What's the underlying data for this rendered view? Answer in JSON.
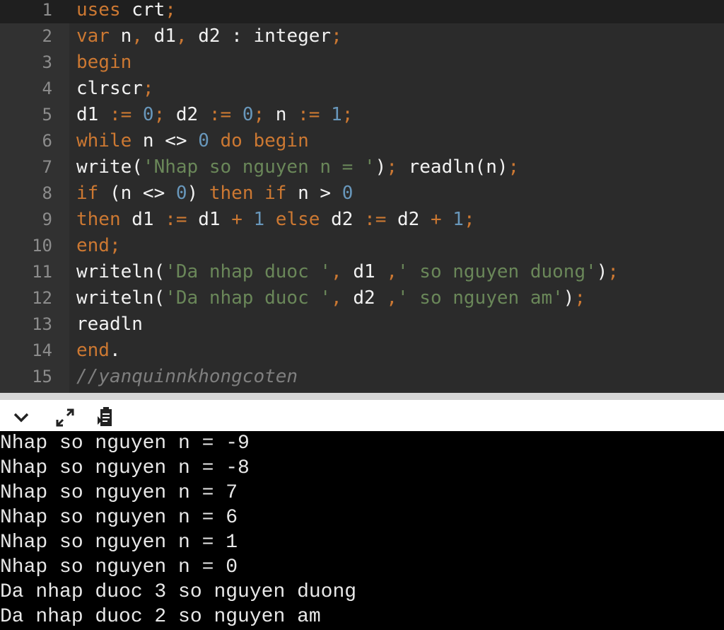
{
  "editor": {
    "lines": [
      {
        "n": "1",
        "tokens": [
          [
            "kw",
            "uses"
          ],
          [
            "",
            " crt"
          ],
          [
            "op",
            ";"
          ]
        ]
      },
      {
        "n": "2",
        "tokens": [
          [
            "kw",
            "var"
          ],
          [
            "",
            " n"
          ],
          [
            "op",
            ","
          ],
          [
            "",
            " d1"
          ],
          [
            "op",
            ","
          ],
          [
            "",
            " d2 : integer"
          ],
          [
            "op",
            ";"
          ]
        ]
      },
      {
        "n": "3",
        "tokens": [
          [
            "kw",
            "begin"
          ]
        ]
      },
      {
        "n": "4",
        "tokens": [
          [
            "",
            "clrscr"
          ],
          [
            "op",
            ";"
          ]
        ]
      },
      {
        "n": "5",
        "tokens": [
          [
            "",
            "d1 "
          ],
          [
            "op",
            ":="
          ],
          [
            "num",
            " 0"
          ],
          [
            "op",
            ";"
          ],
          [
            "",
            " d2 "
          ],
          [
            "op",
            ":="
          ],
          [
            "num",
            " 0"
          ],
          [
            "op",
            ";"
          ],
          [
            "",
            " n "
          ],
          [
            "op",
            ":="
          ],
          [
            "num",
            " 1"
          ],
          [
            "op",
            ";"
          ]
        ]
      },
      {
        "n": "6",
        "tokens": [
          [
            "kw",
            "while"
          ],
          [
            "",
            " n <> "
          ],
          [
            "num",
            "0"
          ],
          [
            "kw",
            " do begin"
          ]
        ]
      },
      {
        "n": "7",
        "tokens": [
          [
            "",
            "write("
          ],
          [
            "str",
            "'Nhap so nguyen n = '"
          ],
          [
            "",
            ")"
          ],
          [
            "op",
            ";"
          ],
          [
            "",
            " readln(n)"
          ],
          [
            "op",
            ";"
          ]
        ]
      },
      {
        "n": "8",
        "tokens": [
          [
            "kw",
            "if"
          ],
          [
            "",
            " (n <> "
          ],
          [
            "num",
            "0"
          ],
          [
            "",
            ")"
          ],
          [
            "kw",
            " then if"
          ],
          [
            "",
            " n > "
          ],
          [
            "num",
            "0"
          ]
        ]
      },
      {
        "n": "9",
        "tokens": [
          [
            "kw",
            "then"
          ],
          [
            "",
            " d1 "
          ],
          [
            "op",
            ":="
          ],
          [
            "",
            " d1 "
          ],
          [
            "op",
            "+"
          ],
          [
            "num",
            " 1"
          ],
          [
            "kw",
            " else"
          ],
          [
            "",
            " d2 "
          ],
          [
            "op",
            ":="
          ],
          [
            "",
            " d2 "
          ],
          [
            "op",
            "+"
          ],
          [
            "num",
            " 1"
          ],
          [
            "op",
            ";"
          ]
        ]
      },
      {
        "n": "10",
        "tokens": [
          [
            "kw",
            "end"
          ],
          [
            "op",
            ";"
          ]
        ]
      },
      {
        "n": "11",
        "tokens": [
          [
            "",
            "writeln("
          ],
          [
            "str",
            "'Da nhap duoc '"
          ],
          [
            "op",
            ","
          ],
          [
            "",
            " d1 "
          ],
          [
            "op",
            ","
          ],
          [
            "str",
            "' so nguyen duong'"
          ],
          [
            "",
            ")"
          ],
          [
            "op",
            ";"
          ]
        ]
      },
      {
        "n": "12",
        "tokens": [
          [
            "",
            "writeln("
          ],
          [
            "str",
            "'Da nhap duoc '"
          ],
          [
            "op",
            ","
          ],
          [
            "",
            " d2 "
          ],
          [
            "op",
            ","
          ],
          [
            "str",
            "' so nguyen am'"
          ],
          [
            "",
            ")"
          ],
          [
            "op",
            ";"
          ]
        ]
      },
      {
        "n": "13",
        "tokens": [
          [
            "",
            "readln"
          ]
        ]
      },
      {
        "n": "14",
        "tokens": [
          [
            "kw",
            "end"
          ],
          [
            "",
            "."
          ]
        ]
      },
      {
        "n": "15",
        "tokens": [
          [
            "cm",
            "//yanquinnkhongcoten"
          ]
        ]
      }
    ]
  },
  "toolbar": {
    "icons": [
      "chevron-down-icon",
      "expand-icon",
      "clipboard-icon"
    ]
  },
  "console": {
    "lines": [
      "Nhap so nguyen n = -9",
      "Nhap so nguyen n = -8",
      "Nhap so nguyen n = 7",
      "Nhap so nguyen n = 6",
      "Nhap so nguyen n = 1",
      "Nhap so nguyen n = 0",
      "Da nhap duoc 3 so nguyen duong",
      "Da nhap duoc 2 so nguyen am"
    ]
  }
}
